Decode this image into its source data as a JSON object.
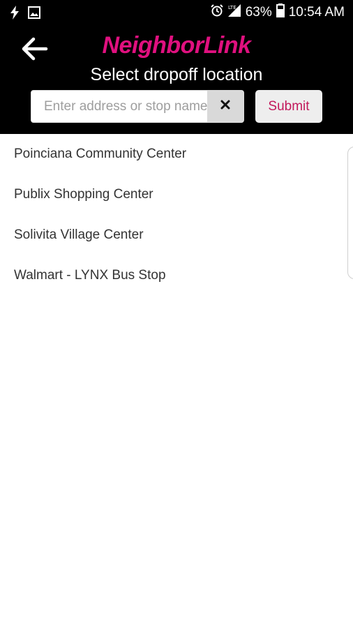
{
  "status_bar": {
    "battery_percent": "63%",
    "time": "10:54 AM"
  },
  "header": {
    "brand": "NeighborLink",
    "title": "Select dropoff location"
  },
  "search": {
    "placeholder": "Enter address or stop name",
    "value": ""
  },
  "submit": {
    "label": "Submit"
  },
  "locations": [
    "Poinciana Community Center",
    "Publix Shopping Center",
    "Solivita Village Center",
    "Walmart - LYNX Bus Stop"
  ],
  "colors": {
    "brand": "#e0107f",
    "submit_text": "#c2185b",
    "header_bg": "#000000"
  }
}
